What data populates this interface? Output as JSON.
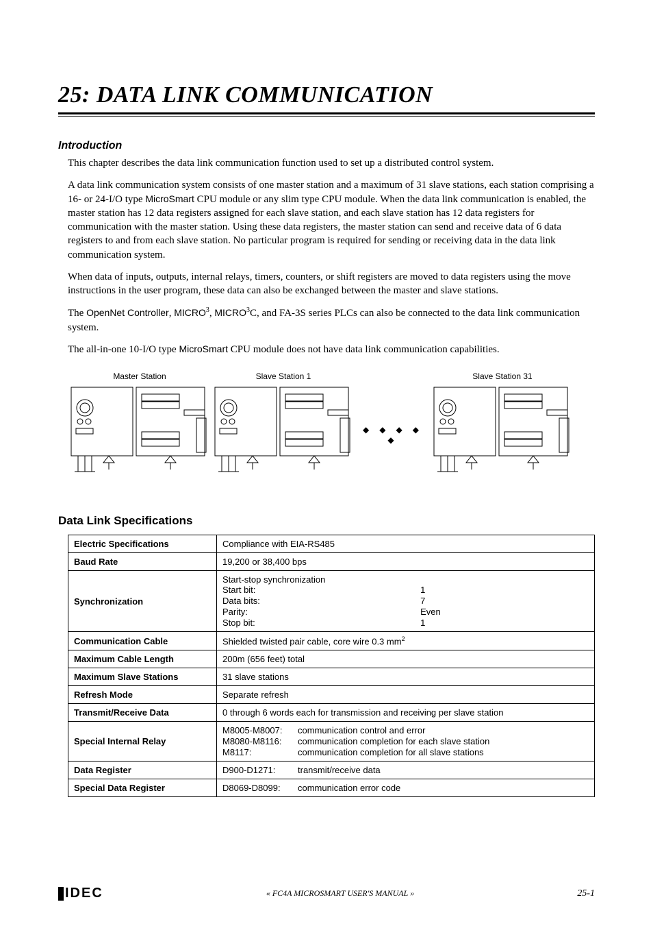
{
  "chapter_num": "25:",
  "chapter_title_rest": " DATA LINK COMMUNICATION",
  "intro_heading": "Introduction",
  "para1": "This chapter describes the data link communication function used to set up a distributed control system.",
  "para2_a": "A data link communication system consists of one master station and a maximum of 31 slave stations, each station comprising a 16- or 24-I/O type ",
  "para2_b": "MicroSmart",
  "para2_c": " CPU module or any slim type CPU module. When the data link communication is enabled, the master station has 12 data registers assigned for each slave station, and each slave station has 12 data registers for communication with the master station. Using these data registers, the master station can send and receive data of 6 data registers to and from each slave station. No particular program is required for sending or receiving data in the data link communication system.",
  "para3": "When data of inputs, outputs, internal relays, timers, counters, or shift registers are moved to data registers using the move instructions in the user program, these data can also be exchanged between the master and slave stations.",
  "para4_a": "The ",
  "para4_b": "OpenNet Controller",
  "para4_c": ", ",
  "para4_d": "MICRO",
  "para4_e": "3",
  "para4_f": ", ",
  "para4_g": "MICRO",
  "para4_h": "3",
  "para4_i": "C, and FA-3S series PLCs can also be connected to the data link communication system.",
  "para5_a": "The all-in-one 10-I/O type ",
  "para5_b": "MicroSmart",
  "para5_c": " CPU module does not have data link communication capabilities.",
  "diagram": {
    "master": "Master Station",
    "slave1": "Slave Station 1",
    "slave31": "Slave Station 31",
    "dots": "◆  ◆  ◆  ◆  ◆"
  },
  "spec_heading": "Data Link Specifications",
  "table": {
    "rows": [
      {
        "label": "Electric Specifications",
        "value": "Compliance with EIA-RS485"
      },
      {
        "label": "Baud Rate",
        "value": "19,200 or 38,400 bps"
      },
      {
        "label": "Synchronization",
        "sync": {
          "line1": "Start-stop synchronization",
          "k1": "Start bit:",
          "v1": "1",
          "k2": "Data bits:",
          "v2": "7",
          "k3": "Parity:",
          "v3": "Even",
          "k4": "Stop bit:",
          "v4": "1"
        }
      },
      {
        "label": "Communication Cable",
        "value_a": "Shielded twisted pair cable, core wire 0.3 mm",
        "value_sup": "2"
      },
      {
        "label": "Maximum Cable Length",
        "value": "200m (656 feet) total"
      },
      {
        "label": "Maximum Slave Stations",
        "value": "31 slave stations"
      },
      {
        "label": "Refresh Mode",
        "value": "Separate refresh"
      },
      {
        "label": "Transmit/Receive Data",
        "value": "0 through 6 words each for transmission and receiving per slave station"
      },
      {
        "label": "Special Internal Relay",
        "relay": {
          "k1": "M8005-M8007:",
          "v1": "communication control and error",
          "k2": "M8080-M8116:",
          "v2": "communication completion for each slave station",
          "k3": "M8117:",
          "v3": "communication completion for all slave stations"
        }
      },
      {
        "label": "Data Register",
        "relay": {
          "k1": "D900-D1271:",
          "v1": "transmit/receive data"
        }
      },
      {
        "label": "Special Data Register",
        "relay": {
          "k1": "D8069-D8099:",
          "v1": "communication error code"
        }
      }
    ]
  },
  "footer": {
    "logo": "IDEC",
    "manual_a": "« FC4A ",
    "manual_b": "MICROSMART USER'S MANUAL",
    "manual_c": " »",
    "page": "25-1"
  }
}
